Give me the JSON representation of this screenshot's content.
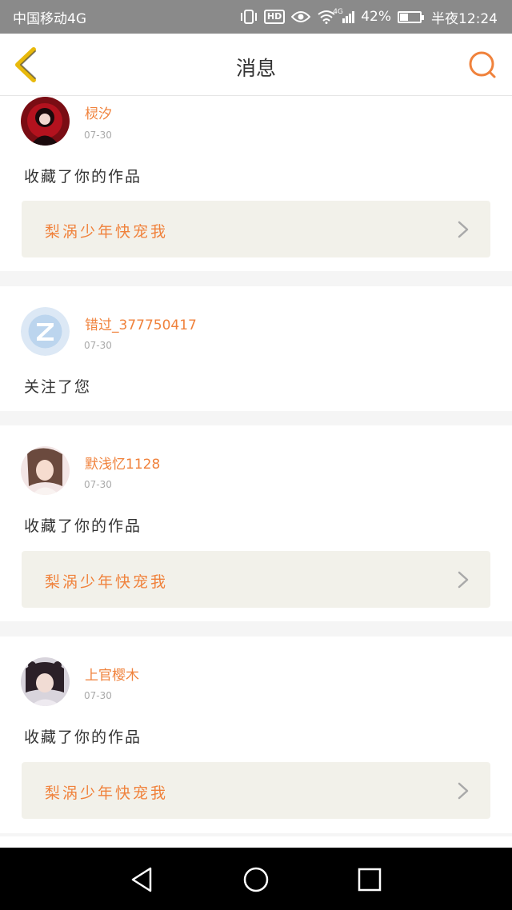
{
  "status_bar": {
    "carrier": "中国移动4G",
    "network_label": "4G",
    "battery_percent": "42%",
    "battery_level": 0.42,
    "time": "半夜12:24",
    "icons": [
      "vibrate-icon",
      "hd-icon",
      "eye-icon",
      "wifi-icon",
      "signal-icon",
      "battery-icon"
    ]
  },
  "header": {
    "title": "消息",
    "back_icon": "chevron-left-icon",
    "search_icon": "search-icon",
    "accent_color": "#f0823c",
    "back_color": "#e8b90c"
  },
  "messages": [
    {
      "username": "棂汐",
      "date": "07-30",
      "action": "收藏了你的作品",
      "work_title": "梨涡少年快宠我"
    },
    {
      "username": "错过_377750417",
      "date": "07-30",
      "action": "关注了您"
    },
    {
      "username": "默浅忆1128",
      "date": "07-30",
      "action": "收藏了你的作品",
      "work_title": "梨涡少年快宠我"
    },
    {
      "username": "上官樱木",
      "date": "07-30",
      "action": "收藏了你的作品",
      "work_title": "梨涡少年快宠我"
    }
  ],
  "system_nav": {
    "icons": [
      "back-triangle-icon",
      "home-circle-icon",
      "recents-square-icon"
    ]
  }
}
